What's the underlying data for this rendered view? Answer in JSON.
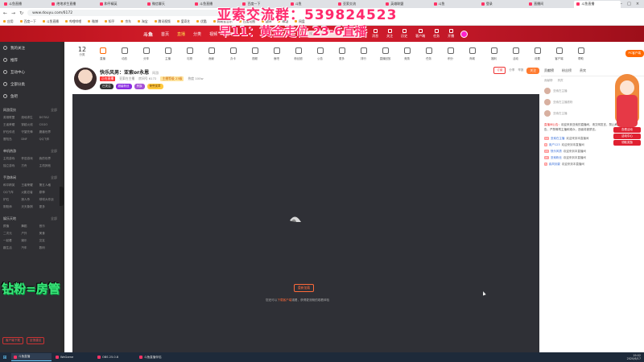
{
  "browser": {
    "tabs": [
      "斗鱼直播",
      "绝地求生直播",
      "和平精英",
      "微信聊天",
      "斗鱼直播",
      "百度一下",
      "斗鱼",
      "亚索交流",
      "英雄联盟",
      "斗鱼",
      "登录",
      "直播间",
      "斗鱼直播"
    ],
    "url": "www.douyu.com/6172",
    "bookmarks": [
      "应用",
      "百度一下",
      "斗鱼直播",
      "哔哩哔哩",
      "微博",
      "知乎",
      "京东",
      "淘宝",
      "腾讯视频",
      "爱奇艺",
      "优酷",
      "网易云音乐",
      "百度地图",
      "翻译",
      "邮箱",
      "网盘"
    ]
  },
  "overlay": {
    "qq": "亚索交流群：539824523",
    "live": "早11：黄金走位 23-6直播",
    "left": "钻粉=房管"
  },
  "header": {
    "logo": "斗鱼",
    "nav": [
      "首页",
      "直播",
      "分类",
      "视频",
      "鱼吧"
    ],
    "search_placeholder": "搜索",
    "icons": [
      {
        "label": "消息",
        "icon": "message-icon"
      },
      {
        "label": "关注",
        "icon": "follow-icon"
      },
      {
        "label": "历史",
        "icon": "history-icon"
      },
      {
        "label": "客户端",
        "icon": "client-icon"
      },
      {
        "label": "任务",
        "icon": "task-icon"
      },
      {
        "label": "开播",
        "icon": "broadcast-icon"
      }
    ]
  },
  "sidebar": {
    "top": [
      "我的关注",
      "推荐",
      "互动中心",
      "全部分类",
      "鱼吧"
    ],
    "sections": [
      {
        "title": "网游竞技",
        "more": "全部",
        "items": [
          "英雄联盟",
          "绝地求生",
          "DOTA2",
          "王者荣耀",
          "穿越火线",
          "CSGO",
          "炉石传说",
          "守望先锋",
          "魔兽世界",
          "冒险岛",
          "DNF",
          "QQ飞车"
        ]
      },
      {
        "title": "单机热游",
        "more": "全部",
        "items": [
          "主机游戏",
          "怀旧游戏",
          "我的世界",
          "独立游戏",
          "方舟",
          "主机其他"
        ]
      },
      {
        "title": "手游休闲",
        "more": "全部",
        "items": [
          "和平精英",
          "王者荣耀",
          "第五人格",
          "QQ飞车",
          "火影忍者",
          "原神",
          "炉石",
          "狼人杀",
          "球球大作战",
          "阴阳师",
          "天天象棋",
          "更多"
        ]
      },
      {
        "title": "娱乐天地",
        "more": "全部",
        "items": [
          "颜值",
          "舞蹈",
          "音乐",
          "二次元",
          "户外",
          "美食",
          "一起看",
          "娱乐",
          "交友",
          "趣生活",
          "汽车",
          "数码"
        ]
      }
    ],
    "bottom": [
      "客户端下载",
      "反馈建议"
    ]
  },
  "categories": {
    "count": "12",
    "count_label": "分类",
    "items": [
      {
        "label": "直播",
        "hot": true
      },
      {
        "label": "动态"
      },
      {
        "label": "分享"
      },
      {
        "label": "主播"
      },
      {
        "label": "礼物"
      },
      {
        "label": "贡献"
      },
      {
        "label": "办卡"
      },
      {
        "label": "视频"
      },
      {
        "label": "鱼吧"
      },
      {
        "label": "粉丝团"
      },
      {
        "label": "公告"
      },
      {
        "label": "更多"
      },
      {
        "label": "排行"
      },
      {
        "label": "直播回放"
      },
      {
        "label": "竞猜"
      },
      {
        "label": "任务"
      },
      {
        "label": "积分"
      },
      {
        "label": "商城"
      },
      {
        "label": "福利"
      },
      {
        "label": "活动"
      },
      {
        "label": "设置"
      },
      {
        "label": "客户端"
      },
      {
        "label": "帮助"
      }
    ],
    "pc_button": "PC客户端"
  },
  "room": {
    "title": "快乐风男：亚索or永恩",
    "tag": "网游",
    "line2": {
      "red": "正在直播",
      "owner": "亚索在主播",
      "id": "房间号 6172",
      "yel": "主播等级 23级",
      "hot": "热度 100w"
    },
    "badges": [
      "已关注",
      "超级粉丝",
      "贵族",
      "荣誉奖章"
    ],
    "actions": {
      "report": "举报",
      "share": "分享",
      "follow": "关注",
      "subscribe": "订阅"
    }
  },
  "player": {
    "reload": "重新加载",
    "tip_prefix": "您还可以",
    "tip_link": "下载客户端",
    "tip_suffix": "观看，获得更流畅的观看体验"
  },
  "right": {
    "tabs": [
      "贡献榜",
      "粉丝榜",
      "贵宾"
    ],
    "rank_head": [
      "贡献榜",
      "贵宾"
    ],
    "ranks": [
      "亚索在主播",
      "亚索在主播铁粉",
      "亚索在主播"
    ],
    "rules_title": "直播间公告：",
    "rules": "欢迎来到亚索的直播间，请文明发言，禁止刷屏，禁止发布广告，严禁辱骂主播和观众，违者将被禁言。",
    "chat": [
      {
        "lv": "12",
        "name": "亚索在主播",
        "msg": "欢迎来到本直播间"
      },
      {
        "lv": "8",
        "name": "用户123",
        "msg": "欢迎来到本直播间"
      },
      {
        "lv": "15",
        "name": "快乐风男",
        "msg": "欢迎来到本直播间"
      },
      {
        "lv": "21",
        "name": "亚索粉丝",
        "msg": "欢迎来到本直播间"
      },
      {
        "lv": "5",
        "name": "疾风剑豪",
        "msg": "欢迎来到本直播间"
      }
    ],
    "anime_labels": [
      "查看活动",
      "活动中心",
      "领取奖励"
    ]
  },
  "taskbar": {
    "items": [
      "斗鱼直播",
      "WeGame",
      "OBS 25.0.8",
      "斗鱼直播伴侣"
    ],
    "time": "19:02",
    "date": "2020/6/17"
  },
  "colors": {
    "header": "#c21828",
    "accent": "#ff6a00",
    "overlay": "#ff2a6d",
    "overlay_green": "#3fe07a"
  }
}
